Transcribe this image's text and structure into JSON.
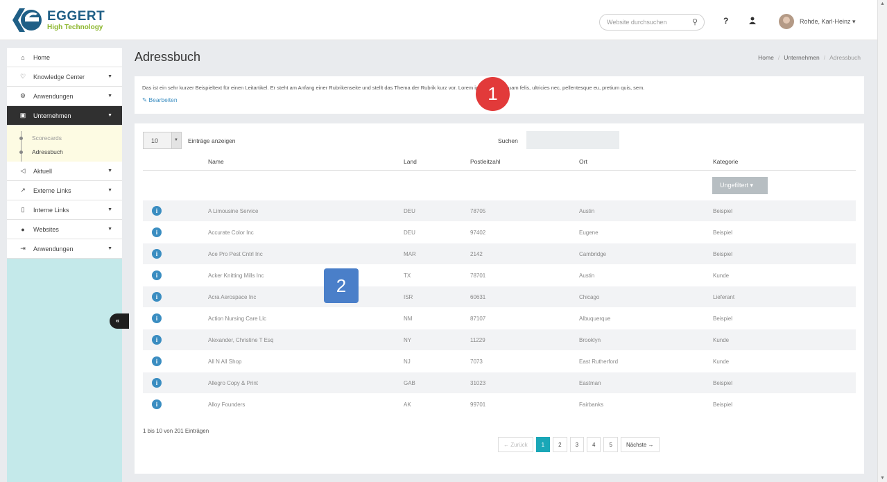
{
  "brand": {
    "name": "EGGERT",
    "tagline": "High Technology",
    "colors": {
      "primary": "#1f5f86",
      "accent": "#8ab52a",
      "teal": "#1aa7b7"
    }
  },
  "header": {
    "search_placeholder": "Website durchsuchen",
    "help_label": "?",
    "user_name": "Rohde, Karl-Heinz ▾"
  },
  "sidebar": {
    "items": [
      {
        "label": "Home",
        "icon": "home-icon",
        "glyph": "⌂"
      },
      {
        "label": "Knowledge Center",
        "icon": "lightbulb-icon",
        "glyph": "♡"
      },
      {
        "label": "Anwendungen",
        "icon": "cogs-icon",
        "glyph": "⚙"
      },
      {
        "label": "Unternehmen",
        "icon": "building-icon",
        "glyph": "▣"
      },
      {
        "label": "Aktuell",
        "icon": "megaphone-icon",
        "glyph": "◁"
      },
      {
        "label": "Externe Links",
        "icon": "external-link-icon",
        "glyph": "↗"
      },
      {
        "label": "Interne Links",
        "icon": "bookmark-icon",
        "glyph": "▯"
      },
      {
        "label": "Websites",
        "icon": "globe-icon",
        "glyph": "●"
      },
      {
        "label": "Anwendungen",
        "icon": "sign-in-icon",
        "glyph": "⇥"
      }
    ],
    "subitems": [
      "Scorecards",
      "Adressbuch"
    ],
    "collapse_label": "«"
  },
  "page": {
    "title": "Adressbuch",
    "breadcrumb": [
      "Home",
      "Unternehmen",
      "Adressbuch"
    ],
    "intro_text": "Das ist ein sehr kurzer Beispieltext für einen Leitartikel. Er steht am Anfang einer Rubrikenseite und stellt das Thema der Rubrik kurz vor. Lorem ipsum donec quam felis, ultricies nec, pellentesque eu, pretium quis, sem.",
    "edit_label": "Bearbeiten"
  },
  "table": {
    "length_value": "10",
    "length_label": "Einträge anzeigen",
    "filter_label": "Suchen",
    "columns": [
      "Name",
      "Land",
      "Postleitzahl",
      "Ort",
      "Kategorie"
    ],
    "category_filter": "Ungefiltert ▾",
    "rows": [
      [
        "A Limousine Service",
        "DEU",
        "78705",
        "Austin",
        "Beispiel"
      ],
      [
        "Accurate Color Inc",
        "DEU",
        "97402",
        "Eugene",
        "Beispiel"
      ],
      [
        "Ace Pro Pest Cntrl Inc",
        "MAR",
        "2142",
        "Cambridge",
        "Beispiel"
      ],
      [
        "Acker Knitting Mills Inc",
        "TX",
        "78701",
        "Austin",
        "Kunde"
      ],
      [
        "Acra Aerospace Inc",
        "ISR",
        "60631",
        "Chicago",
        "Lieferant"
      ],
      [
        "Action Nursing Care Llc",
        "NM",
        "87107",
        "Albuquerque",
        "Beispiel"
      ],
      [
        "Alexander, Christine T Esq",
        "NY",
        "11229",
        "Brooklyn",
        "Kunde"
      ],
      [
        "All N All Shop",
        "NJ",
        "7073",
        "East Rutherford",
        "Kunde"
      ],
      [
        "Allegro Copy & Print",
        "GAB",
        "31023",
        "Eastman",
        "Beispiel"
      ],
      [
        "Alloy Founders",
        "AK",
        "99701",
        "Fairbanks",
        "Beispiel"
      ]
    ],
    "info_text": "1 bis 10 von 201 Einträgen",
    "pagination": {
      "prev": "← Zurück",
      "pages": [
        "1",
        "2",
        "3",
        "4",
        "5"
      ],
      "current": "1",
      "next": "Nächste →"
    }
  },
  "markers": [
    "1",
    "2"
  ]
}
